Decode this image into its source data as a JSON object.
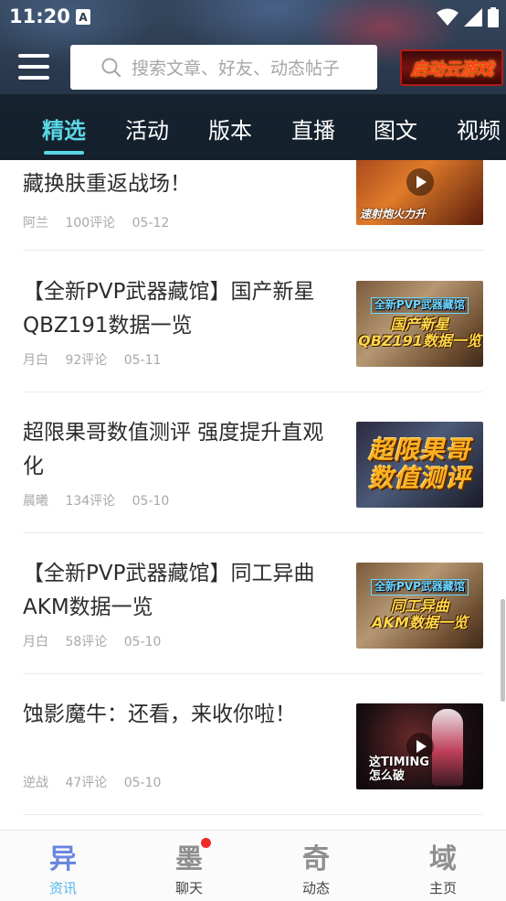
{
  "status_bar": {
    "time": "11:20",
    "notification_icon": "a-icon",
    "icons": [
      "wifi-icon",
      "signal-icon",
      "battery-icon"
    ]
  },
  "header": {
    "menu_icon": "hamburger-menu-icon",
    "search": {
      "placeholder": "搜索文章、好友、动态帖子"
    },
    "cloud_game_button": "启动云游戏"
  },
  "tabs": [
    {
      "label": "精选",
      "active": true
    },
    {
      "label": "活动",
      "active": false
    },
    {
      "label": "版本",
      "active": false
    },
    {
      "label": "直播",
      "active": false
    },
    {
      "label": "图文",
      "active": false
    },
    {
      "label": "视频",
      "active": false
    }
  ],
  "articles": [
    {
      "title": "藏换肤重返战场！",
      "author": "阿兰",
      "comments": "100评论",
      "date": "05-12",
      "thumb_caption": "速射炮火力升",
      "has_video": true
    },
    {
      "title": "【全新PVP武器藏馆】国产新星QBZ191数据一览",
      "author": "月白",
      "comments": "92评论",
      "date": "05-11",
      "thumb_caption_top": "全新PVP武器藏馆",
      "thumb_caption_bottom": "国产新星\nQBZ191数据一览",
      "has_video": false
    },
    {
      "title": "超限果哥数值测评 强度提升直观化",
      "author": "晨曦",
      "comments": "134评论",
      "date": "05-10",
      "thumb_caption": "超限果哥\n数值测评",
      "has_video": false
    },
    {
      "title": "【全新PVP武器藏馆】同工异曲AKM数据一览",
      "author": "月白",
      "comments": "58评论",
      "date": "05-10",
      "thumb_caption_top": "全新PVP武器藏馆",
      "thumb_caption_bottom": "同工异曲\nAKM数据一览",
      "has_video": false
    },
    {
      "title": "蚀影魔牛：还看，来收你啦！",
      "author": "逆战",
      "comments": "47评论",
      "date": "05-10",
      "thumb_caption": "这TIMING\n怎么破",
      "has_video": true
    }
  ],
  "bottom_nav": [
    {
      "label": "资讯",
      "glyph": "异",
      "icon": "news-icon",
      "active": true,
      "badge": false
    },
    {
      "label": "聊天",
      "glyph": "墨",
      "icon": "chat-icon",
      "active": false,
      "badge": true
    },
    {
      "label": "动态",
      "glyph": "奇",
      "icon": "feed-icon",
      "active": false,
      "badge": false
    },
    {
      "label": "主页",
      "glyph": "域",
      "icon": "home-icon",
      "active": false,
      "badge": false
    }
  ],
  "colors": {
    "accent": "#5bd7e4",
    "header_bg": "#1d2b3b",
    "badge": "#ee2a2a",
    "nav_active": "#4fb6e8"
  }
}
